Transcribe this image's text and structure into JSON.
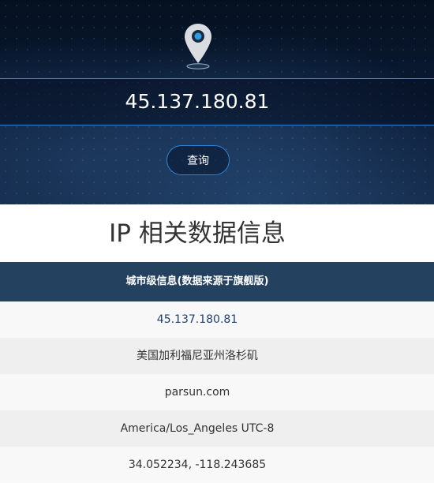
{
  "search": {
    "ip_value": "45.137.180.81",
    "query_label": "查询"
  },
  "result": {
    "title": "IP 相关数据信息",
    "header": "城市级信息(数据来源于旗舰版)",
    "rows": [
      "45.137.180.81",
      "美国加利福尼亚州洛杉矶",
      "parsun.com",
      "America/Los_Angeles UTC-8",
      "34.052234, -118.243685"
    ]
  },
  "icons": {
    "pin": "location-pin-icon"
  },
  "colors": {
    "header_bg": "#244260",
    "accent_line": "#2f7fd0",
    "ip_text": "#1f3f76"
  }
}
